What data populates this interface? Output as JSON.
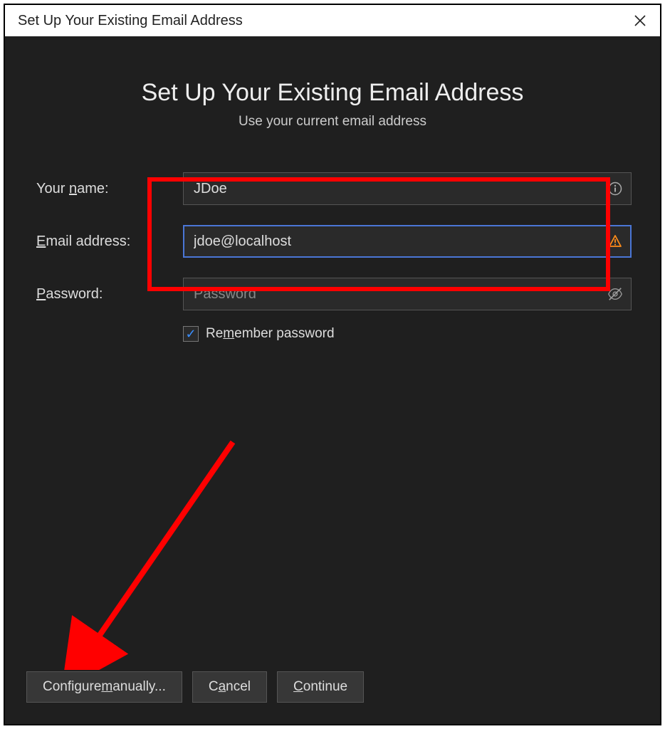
{
  "window": {
    "title": "Set Up Your Existing Email Address"
  },
  "header": {
    "heading": "Set Up Your Existing Email Address",
    "subheading": "Use your current email address"
  },
  "form": {
    "name_label_pre": "Your ",
    "name_label_ul": "n",
    "name_label_post": "ame:",
    "name_value": "JDoe",
    "email_label_ul": "E",
    "email_label_post": "mail address:",
    "email_value": "jdoe@localhost",
    "password_label_ul": "P",
    "password_label_post": "assword:",
    "password_placeholder": "Password",
    "remember_pre": "Re",
    "remember_ul": "m",
    "remember_post": "ember password",
    "remember_checked": true
  },
  "buttons": {
    "configure_pre": "Configure ",
    "configure_ul": "m",
    "configure_post": "anually...",
    "cancel_pre": "C",
    "cancel_ul": "a",
    "cancel_post": "ncel",
    "continue_ul": "C",
    "continue_post": "ontinue"
  }
}
